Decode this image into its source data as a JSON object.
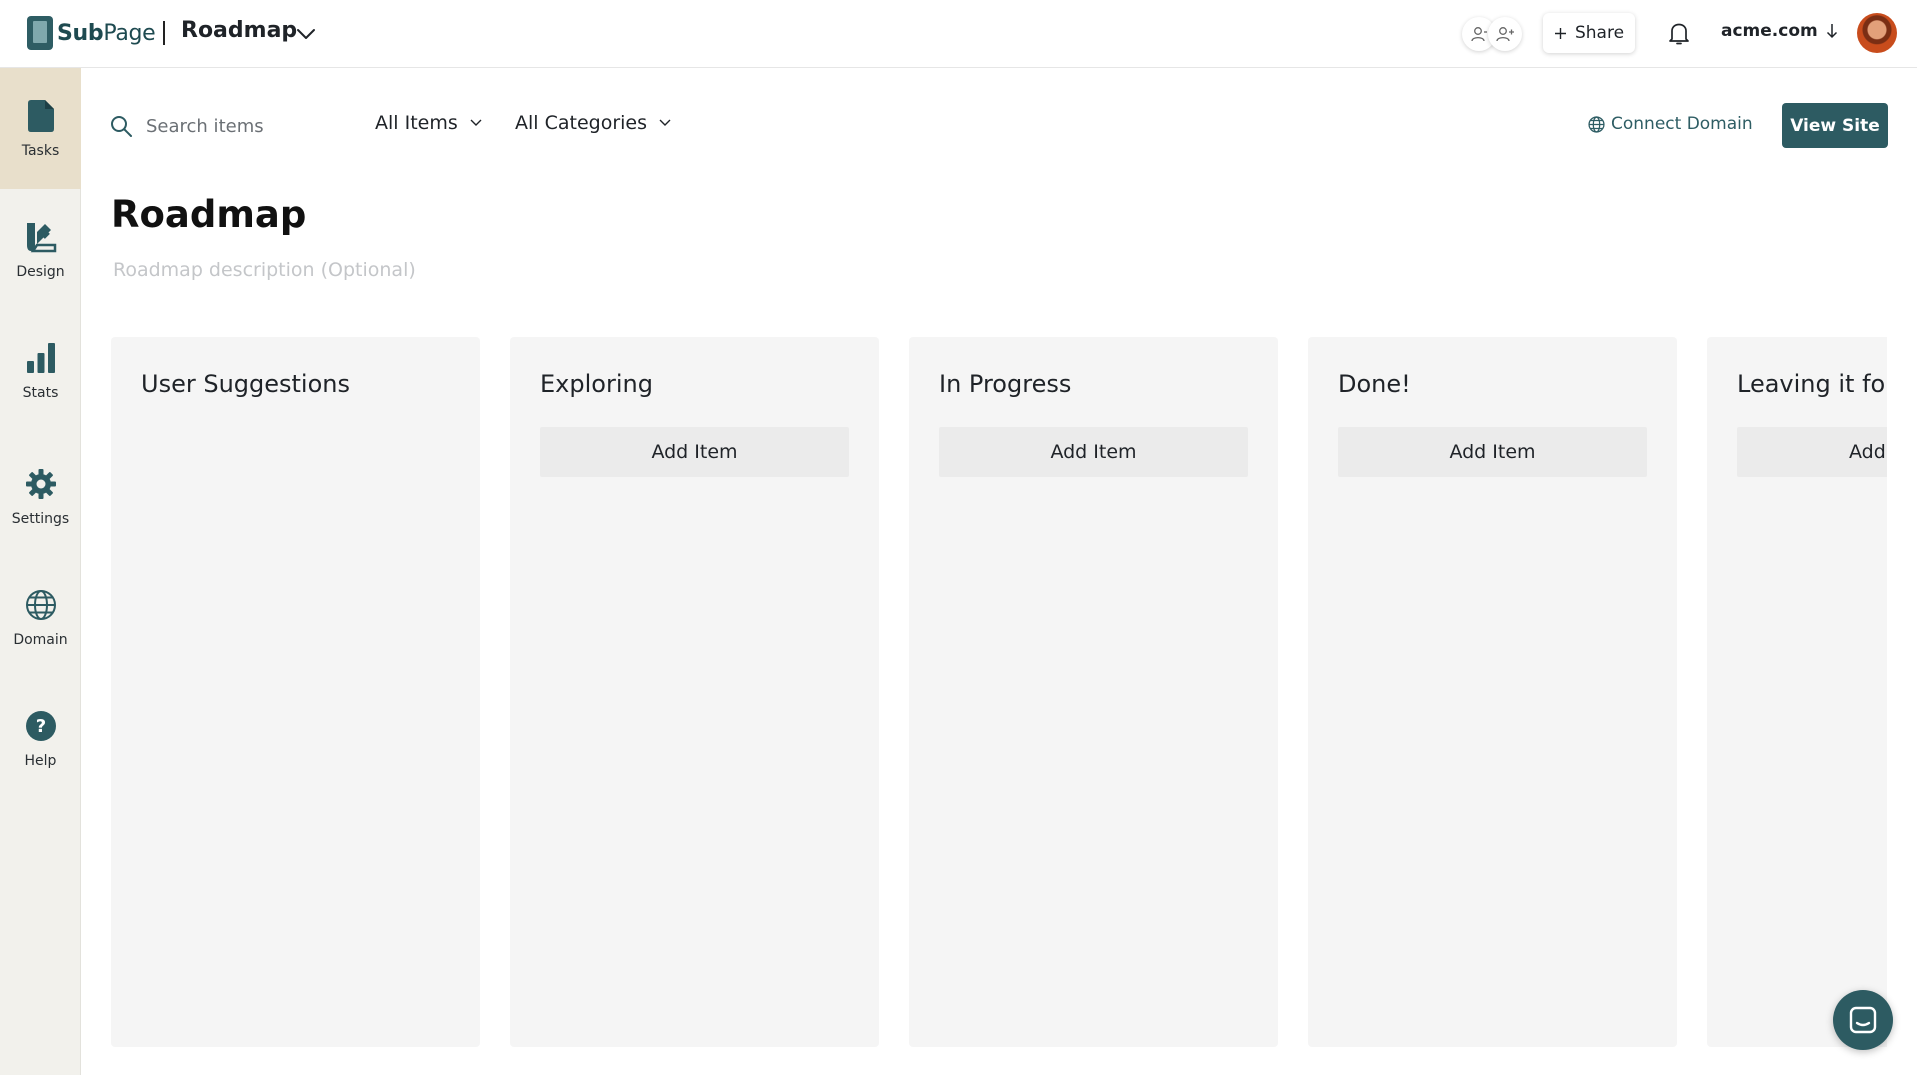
{
  "app": {
    "logo_bold": "Sub",
    "logo_light": "Page",
    "project_title": "Roadmap"
  },
  "header": {
    "share_label": "Share",
    "domain_label": "acme.com"
  },
  "sidebar": {
    "items": [
      {
        "label": "Tasks",
        "icon": "document-icon"
      },
      {
        "label": "Design",
        "icon": "design-icon"
      },
      {
        "label": "Stats",
        "icon": "bar-chart-icon"
      },
      {
        "label": "Settings",
        "icon": "gear-icon"
      },
      {
        "label": "Domain",
        "icon": "globe-icon"
      },
      {
        "label": "Help",
        "icon": "help-icon"
      }
    ],
    "active": "Tasks"
  },
  "toolbar": {
    "search_placeholder": "Search items",
    "filter_items": "All Items",
    "filter_categories": "All Categories",
    "connect_domain": "Connect Domain",
    "view_site": "View Site"
  },
  "page": {
    "title": "Roadmap",
    "description_placeholder": "Roadmap description (Optional)"
  },
  "board": {
    "columns": [
      {
        "title": "User Suggestions",
        "add_label": ""
      },
      {
        "title": "Exploring",
        "add_label": "Add Item"
      },
      {
        "title": "In Progress",
        "add_label": "Add Item"
      },
      {
        "title": "Done!",
        "add_label": "Add Item"
      },
      {
        "title": "Leaving it for",
        "add_label": "Add"
      }
    ]
  },
  "colors": {
    "brand": "#2d5b62",
    "sidebar_bg": "#f2f1ec",
    "sidebar_active": "#e8dfcb",
    "column_bg": "#f5f5f5"
  }
}
